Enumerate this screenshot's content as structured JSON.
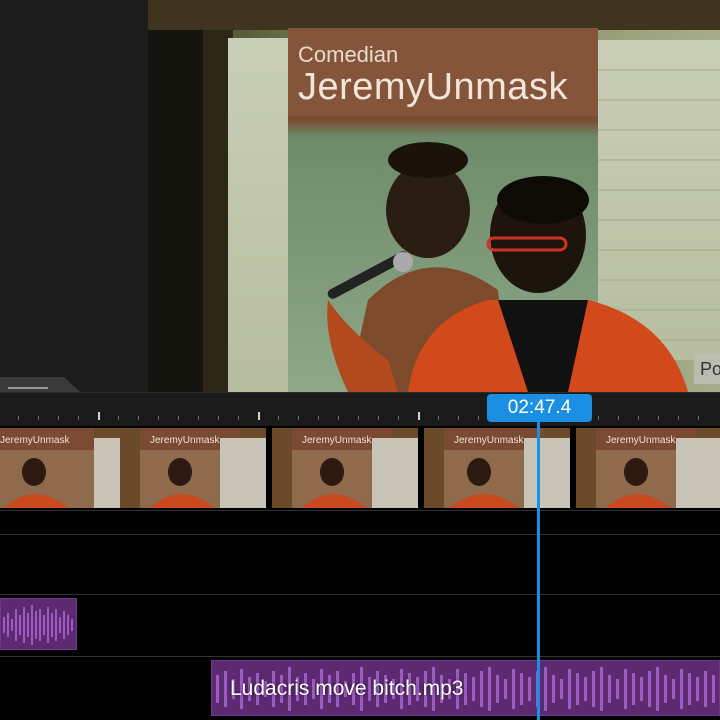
{
  "preview": {
    "banner_subtitle": "Comedian",
    "banner_title": "JeremyUnmask",
    "partial_overlay_text": "Po"
  },
  "timeline": {
    "playhead_time": "02:47.4",
    "video_track": {
      "thumbnail_banner_text": "JeremyUnmask",
      "thumbnail_count": 5
    },
    "audio_clips": [
      {
        "name": ""
      },
      {
        "name": "Ludacris move bitch.mp3"
      }
    ]
  },
  "colors": {
    "playhead": "#1a8fe3",
    "audio_clip": "#5d2a72",
    "waveform": "#9b5cbf"
  },
  "icons": {
    "collapse_handle": "drag-handle-icon"
  }
}
